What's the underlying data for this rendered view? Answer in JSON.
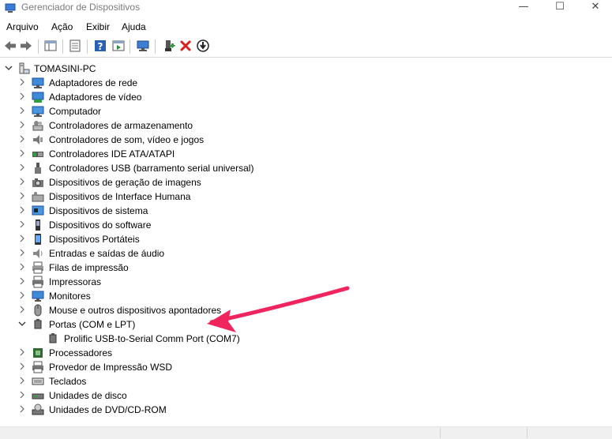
{
  "window": {
    "title": "Gerenciador de Dispositivos",
    "minimize": "—",
    "maximize": "☐",
    "close": "✕"
  },
  "menu": [
    "Arquivo",
    "Ação",
    "Exibir",
    "Ajuda"
  ],
  "tree": {
    "root": "TOMASINI-PC",
    "categories": [
      {
        "label": "Adaptadores de rede",
        "icon": "network-adapter-icon"
      },
      {
        "label": "Adaptadores de vídeo",
        "icon": "display-adapter-icon"
      },
      {
        "label": "Computador",
        "icon": "computer-icon"
      },
      {
        "label": "Controladores de armazenamento",
        "icon": "storage-controller-icon"
      },
      {
        "label": "Controladores de som, vídeo e jogos",
        "icon": "sound-icon"
      },
      {
        "label": "Controladores IDE ATA/ATAPI",
        "icon": "ide-controller-icon"
      },
      {
        "label": "Controladores USB (barramento serial universal)",
        "icon": "usb-icon"
      },
      {
        "label": "Dispositivos de geração de imagens",
        "icon": "camera-icon"
      },
      {
        "label": "Dispositivos de Interface Humana",
        "icon": "hid-icon"
      },
      {
        "label": "Dispositivos de sistema",
        "icon": "system-device-icon"
      },
      {
        "label": "Dispositivos do software",
        "icon": "software-device-icon"
      },
      {
        "label": "Dispositivos Portáteis",
        "icon": "portable-device-icon"
      },
      {
        "label": "Entradas e saídas de áudio",
        "icon": "speaker-icon"
      },
      {
        "label": "Filas de impressão",
        "icon": "print-queue-icon"
      },
      {
        "label": "Impressoras",
        "icon": "printer-icon"
      },
      {
        "label": "Monitores",
        "icon": "monitor-icon"
      },
      {
        "label": "Mouse e outros dispositivos apontadores",
        "icon": "mouse-icon"
      },
      {
        "label": "Portas (COM e LPT)",
        "icon": "port-icon",
        "expanded": true,
        "children": [
          "Prolific USB-to-Serial Comm Port (COM7)"
        ]
      },
      {
        "label": "Processadores",
        "icon": "processor-icon"
      },
      {
        "label": "Provedor de Impressão WSD",
        "icon": "wsd-printer-icon"
      },
      {
        "label": "Teclados",
        "icon": "keyboard-icon"
      },
      {
        "label": "Unidades de disco",
        "icon": "disk-drive-icon"
      },
      {
        "label": "Unidades de DVD/CD-ROM",
        "icon": "dvd-drive-icon"
      }
    ]
  },
  "colors": {
    "annotation_arrow": "#f0245f",
    "delete_red": "#d81e1e"
  }
}
